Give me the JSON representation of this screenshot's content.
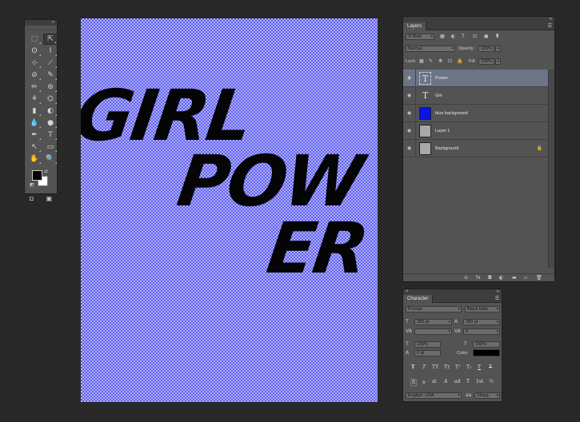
{
  "tools": {
    "items": [
      "⬚",
      "⇱",
      "ʘ",
      "⌇",
      "⊹",
      "⟋",
      "⊘",
      "✎",
      "✏",
      "⊚",
      "⚘",
      "⌬",
      "▮",
      "◐",
      "💧",
      "●",
      "✒",
      "T",
      "↖",
      "▭",
      "✋",
      "🔍"
    ],
    "swap_symbol": "⇄",
    "default_colors_symbol": "◩",
    "quickmask_symbol": "◘",
    "screenmode_symbol": "▣",
    "foreground_color": "#000000",
    "background_color": "#ffffff"
  },
  "canvas": {
    "line1": "GIRL",
    "line2": "POW",
    "line3": "ER"
  },
  "layers_panel": {
    "tab": "Layers",
    "filter_kind": "Kind",
    "blend_mode": "Normal",
    "opacity_label": "Opacity:",
    "opacity_value": "100%",
    "lock_label": "Lock:",
    "fill_label": "Fill:",
    "fill_value": "100%",
    "layers": [
      {
        "name": "Power",
        "type": "text",
        "selected": true
      },
      {
        "name": "Girl",
        "type": "text",
        "selected": false
      },
      {
        "name": "blue background",
        "type": "blue",
        "selected": false
      },
      {
        "name": "Layer 1",
        "type": "gray",
        "selected": false
      },
      {
        "name": "Background",
        "type": "gray",
        "selected": false,
        "locked": true
      }
    ],
    "footer_icons": [
      "⊝",
      "fx",
      "◘",
      "◐",
      "▬",
      "▫",
      "🗑"
    ]
  },
  "character_panel": {
    "tab": "Character",
    "font_family": "Prompt",
    "font_style": "Black Italic",
    "font_size": "350 pt",
    "leading": "280 pt",
    "kerning": "",
    "tracking": "0",
    "vertical_scale": "100%",
    "horizontal_scale": "100%",
    "baseline_shift": "0 pt",
    "color_label": "Color:",
    "color_value": "#000000",
    "style_buttons": [
      "T",
      "T",
      "TT",
      "Tт",
      "T¹",
      "T₁",
      "T",
      "T"
    ],
    "opentype_buttons": [
      "fi",
      "ꝺ",
      "st",
      "A",
      "ad",
      "T",
      "1st",
      "½"
    ],
    "language": "English: USA",
    "anti_alias": "Sharp"
  }
}
